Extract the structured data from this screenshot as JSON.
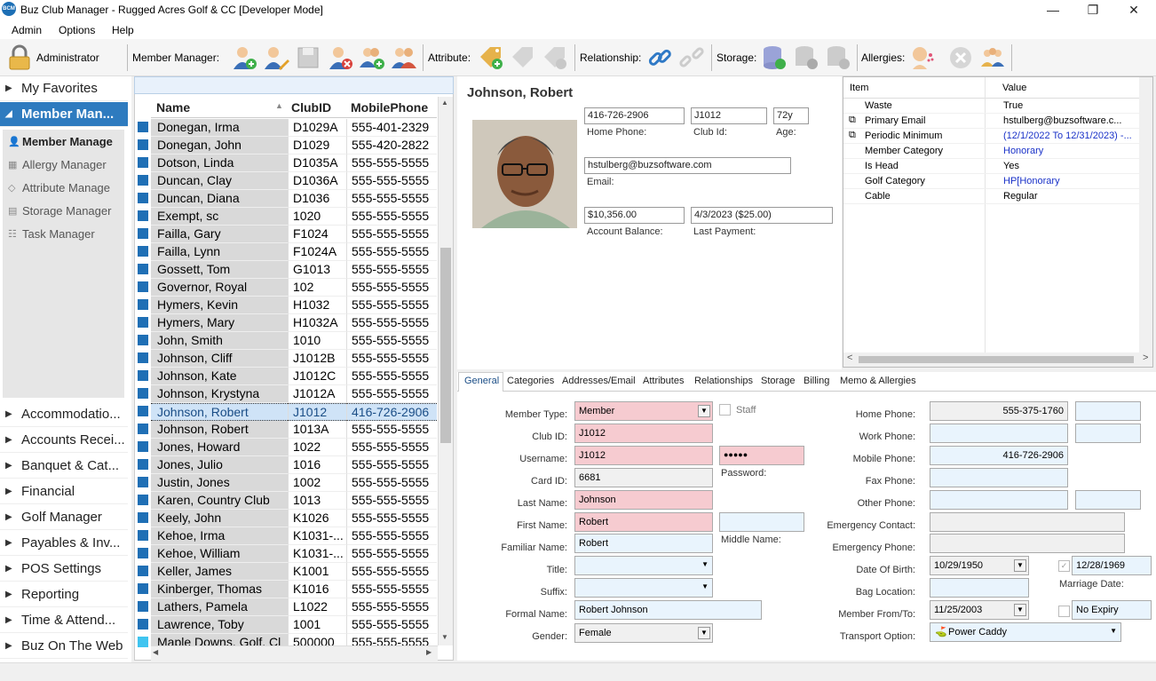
{
  "window": {
    "title": "Buz Club Manager - Rugged Acres Golf & CC [Developer Mode]",
    "minimize": "—",
    "maximize": "❐",
    "close": "✕",
    "app_icon": "BCM"
  },
  "menu": [
    "Admin",
    "Options",
    "Help"
  ],
  "toolbar": {
    "user": "Administrator",
    "member_manager": "Member Manager:",
    "attribute": "Attribute:",
    "relationship": "Relationship:",
    "storage": "Storage:",
    "allergies": "Allergies:"
  },
  "nav": {
    "favorites": "My Favorites",
    "member": "Member Man...",
    "sub": [
      "Member Manage",
      "Allergy Manager",
      "Attribute Manage",
      "Storage Manager",
      "Task Manager"
    ],
    "groups": [
      "Accommodatio...",
      "Accounts Recei...",
      "Banquet & Cat...",
      "Financial",
      "Golf Manager",
      "Payables & Inv...",
      "POS Settings",
      "Reporting",
      "Time & Attend...",
      "Buz On The Web"
    ]
  },
  "grid": {
    "columns": [
      "Name",
      "ClubID",
      "MobilePhone"
    ],
    "rows": [
      [
        "Donegan, Irma",
        "D1029A",
        "555-401-2329"
      ],
      [
        "Donegan, John",
        "D1029",
        "555-420-2822"
      ],
      [
        "Dotson, Linda",
        "D1035A",
        "555-555-5555"
      ],
      [
        "Duncan, Clay",
        "D1036A",
        "555-555-5555"
      ],
      [
        "Duncan, Diana",
        "D1036",
        "555-555-5555"
      ],
      [
        "Exempt, sc",
        "1020",
        "555-555-5555"
      ],
      [
        "Failla, Gary",
        "F1024",
        "555-555-5555"
      ],
      [
        "Failla, Lynn",
        "F1024A",
        "555-555-5555"
      ],
      [
        "Gossett, Tom",
        "G1013",
        "555-555-5555"
      ],
      [
        "Governor, Royal",
        "102",
        "555-555-5555"
      ],
      [
        "Hymers, Kevin",
        "H1032",
        "555-555-5555"
      ],
      [
        "Hymers, Mary",
        "H1032A",
        "555-555-5555"
      ],
      [
        "John, Smith",
        "1010",
        "555-555-5555"
      ],
      [
        "Johnson, Cliff",
        "J1012B",
        "555-555-5555"
      ],
      [
        "Johnson, Kate",
        "J1012C",
        "555-555-5555"
      ],
      [
        "Johnson, Krystyna",
        "J1012A",
        "555-555-5555"
      ],
      [
        "Johnson, Robert",
        "J1012",
        "416-726-2906"
      ],
      [
        "Johnson, Robert",
        "1013A",
        "555-555-5555"
      ],
      [
        "Jones, Howard",
        "1022",
        "555-555-5555"
      ],
      [
        "Jones, Julio",
        "1016",
        "555-555-5555"
      ],
      [
        "Justin, Jones",
        "1002",
        "555-555-5555"
      ],
      [
        "Karen, Country Club",
        "1013",
        "555-555-5555"
      ],
      [
        "Keely, John",
        "K1026",
        "555-555-5555"
      ],
      [
        "Kehoe, Irma",
        "K1031-...",
        "555-555-5555"
      ],
      [
        "Kehoe, William",
        "K1031-...",
        "555-555-5555"
      ],
      [
        "Keller, James",
        "K1001",
        "555-555-5555"
      ],
      [
        "Kinberger, Thomas",
        "K1016",
        "555-555-5555"
      ],
      [
        "Lathers, Pamela",
        "L1022",
        "555-555-5555"
      ],
      [
        "Lawrence, Toby",
        "1001",
        "555-555-5555"
      ],
      [
        "Maple Downs, Golf, Cl",
        "500000",
        "555-555-5555"
      ]
    ],
    "selected_index": 16
  },
  "detail": {
    "name": "Johnson, Robert",
    "home_phone": "416-726-2906",
    "club_id": "J1012",
    "age": "72y",
    "email": "hstulberg@buzsoftware.com",
    "balance": "$10,356.00",
    "last_payment": "4/3/2023 ($25.00)",
    "labels": {
      "home_phone": "Home Phone:",
      "club_id": "Club Id:",
      "age": "Age:",
      "email": "Email:",
      "balance": "Account Balance:",
      "last_payment": "Last Payment:"
    }
  },
  "attributes": {
    "headers": [
      "Item",
      "Value"
    ],
    "rows": [
      [
        "Waste",
        "True",
        "#000000"
      ],
      [
        "Primary Email",
        "hstulberg@buzsoftware.c...",
        "#000000"
      ],
      [
        "Periodic Minimum",
        "(12/1/2022 To 12/31/2023) -...",
        "#1a32c8"
      ],
      [
        "Member Category",
        "Honorary",
        "#1a32c8"
      ],
      [
        "Is Head",
        "Yes",
        "#000000"
      ],
      [
        "Golf Category",
        "HP[Honorary",
        "#1a32c8"
      ],
      [
        "Cable",
        "Regular",
        "#000000"
      ]
    ]
  },
  "tabs": [
    "General",
    "Categories",
    "Addresses/Email",
    "Attributes",
    "Relationships",
    "Storage",
    "Billing",
    "Memo & Allergies"
  ],
  "form": {
    "member_type_label": "Member Type:",
    "member_type": "Member",
    "staff_label": "Staff",
    "club_id_label": "Club ID:",
    "club_id": "J1012",
    "username_label": "Username:",
    "username": "J1012",
    "password": "●●●●●",
    "password_label": "Password:",
    "card_id_label": "Card ID:",
    "card_id": "6681",
    "last_name_label": "Last Name:",
    "last_name": "Johnson",
    "first_name_label": "First Name:",
    "first_name": "Robert",
    "middle_name_label": "Middle Name:",
    "familiar_name_label": "Familiar Name:",
    "familiar_name": "Robert",
    "title_label": "Title:",
    "suffix_label": "Suffix:",
    "formal_name_label": "Formal Name:",
    "formal_name": "Robert Johnson",
    "gender_label": "Gender:",
    "gender": "Female",
    "home_phone_label": "Home Phone:",
    "home_phone": "555-375-1760",
    "work_phone_label": "Work Phone:",
    "mobile_phone_label": "Mobile Phone:",
    "mobile_phone": "416-726-2906",
    "fax_phone_label": "Fax Phone:",
    "other_phone_label": "Other Phone:",
    "emergency_contact_label": "Emergency Contact:",
    "emergency_phone_label": "Emergency Phone:",
    "dob_label": "Date Of Birth:",
    "dob": "10/29/1950",
    "marriage_date": "12/28/1969",
    "marriage_label": "Marriage Date:",
    "bag_location_label": "Bag Location:",
    "member_from_label": "Member From/To:",
    "member_from": "11/25/2003",
    "no_expiry": "No Expiry",
    "transport_label": "Transport Option:",
    "transport": "Power Caddy"
  }
}
